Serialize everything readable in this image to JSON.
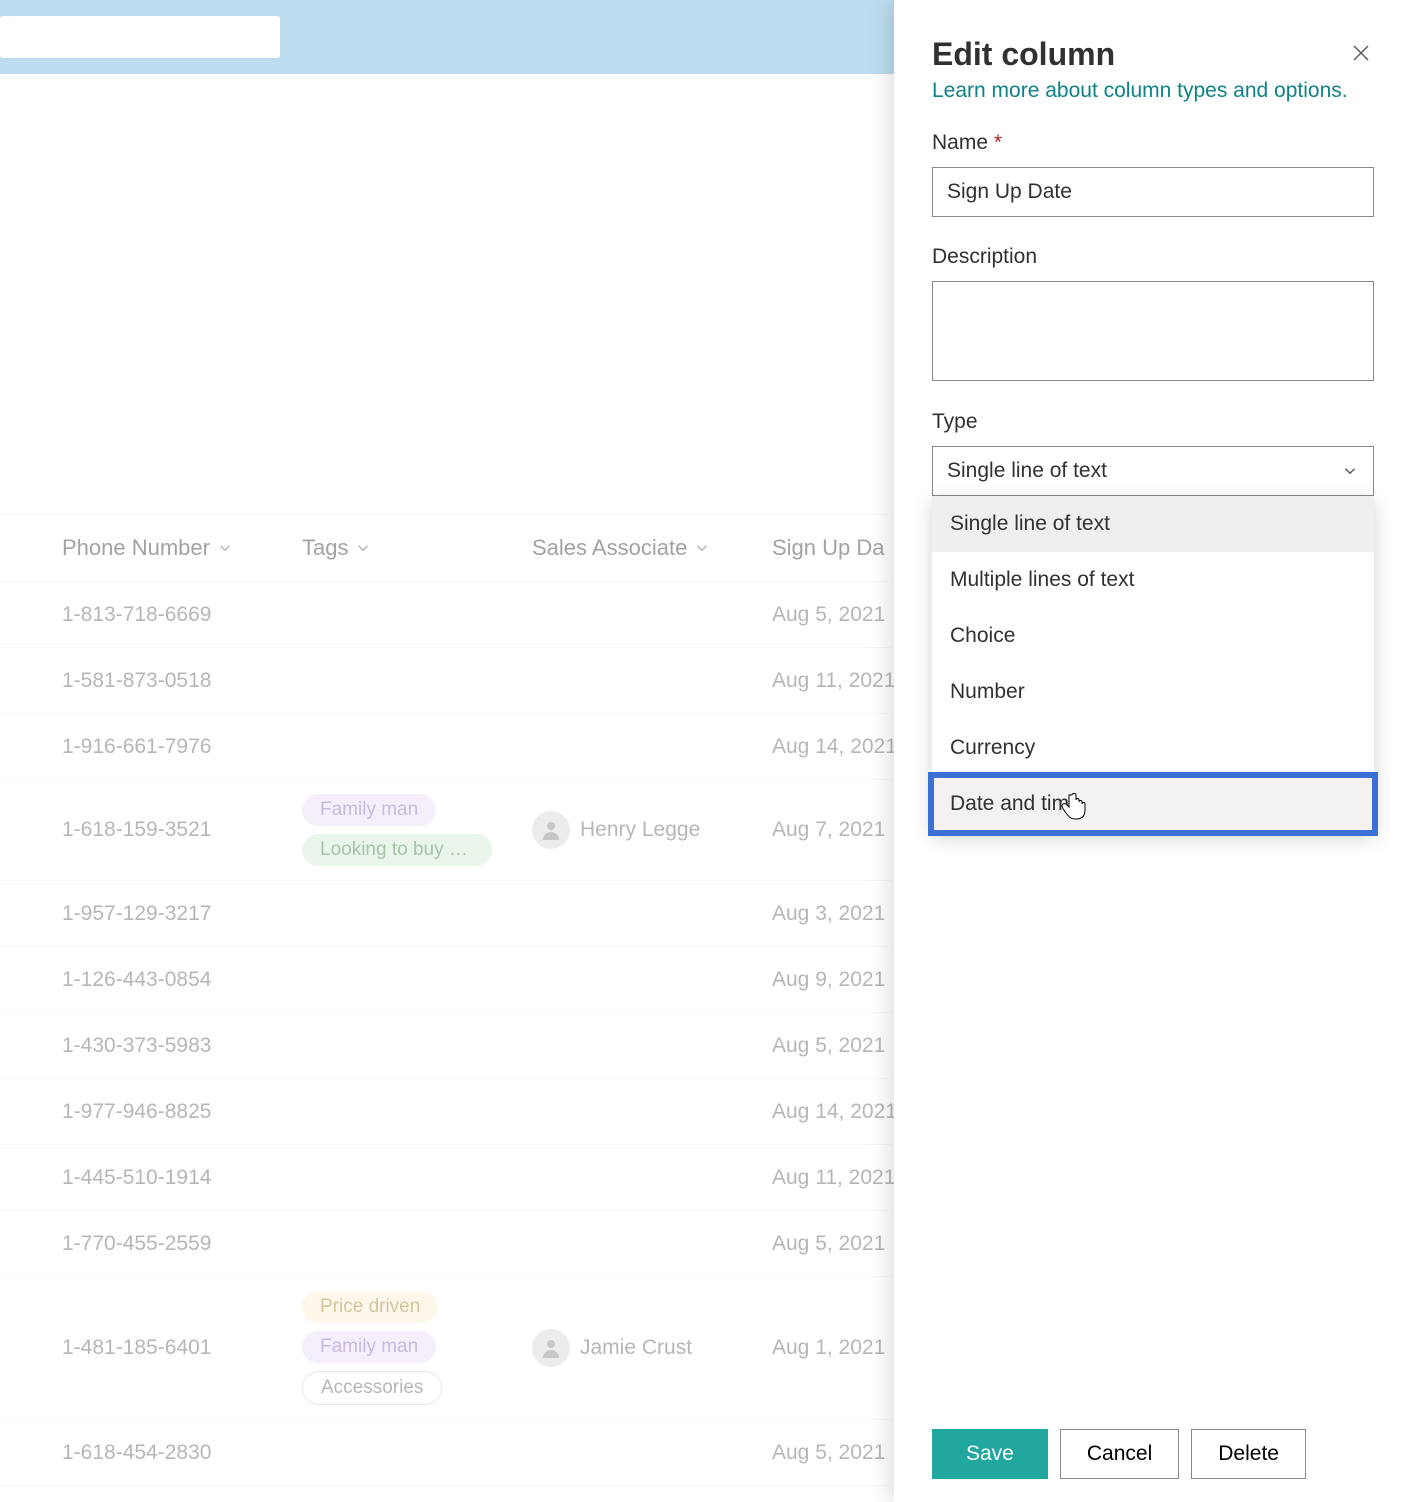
{
  "panel": {
    "title": "Edit column",
    "learn_more": "Learn more about column types and options.",
    "name_label": "Name",
    "name_required": "*",
    "name_value": "Sign Up Date",
    "description_label": "Description",
    "description_value": "",
    "type_label": "Type",
    "type_value": "Single line of text",
    "type_options": [
      "Single line of text",
      "Multiple lines of text",
      "Choice",
      "Number",
      "Currency",
      "Date and time"
    ]
  },
  "buttons": {
    "save": "Save",
    "cancel": "Cancel",
    "delete": "Delete"
  },
  "table": {
    "headers": {
      "phone": "Phone Number",
      "tags": "Tags",
      "assoc": "Sales Associate",
      "date": "Sign Up Da"
    },
    "rows": [
      {
        "phone": "1-813-718-6669",
        "tags": [],
        "assoc": "",
        "date": "Aug 5, 2021"
      },
      {
        "phone": "1-581-873-0518",
        "tags": [],
        "assoc": "",
        "date": "Aug 11, 2021"
      },
      {
        "phone": "1-916-661-7976",
        "tags": [],
        "assoc": "",
        "date": "Aug 14, 2021"
      },
      {
        "phone": "1-618-159-3521",
        "tags": [
          {
            "text": "Family man",
            "c": "purple"
          },
          {
            "text": "Looking to buy s...",
            "c": "green"
          }
        ],
        "assoc": "Henry Legge",
        "date": "Aug 7, 2021"
      },
      {
        "phone": "1-957-129-3217",
        "tags": [],
        "assoc": "",
        "date": "Aug 3, 2021"
      },
      {
        "phone": "1-126-443-0854",
        "tags": [],
        "assoc": "",
        "date": "Aug 9, 2021"
      },
      {
        "phone": "1-430-373-5983",
        "tags": [],
        "assoc": "",
        "date": "Aug 5, 2021"
      },
      {
        "phone": "1-977-946-8825",
        "tags": [],
        "assoc": "",
        "date": "Aug 14, 2021"
      },
      {
        "phone": "1-445-510-1914",
        "tags": [],
        "assoc": "",
        "date": "Aug 11, 2021"
      },
      {
        "phone": "1-770-455-2559",
        "tags": [],
        "assoc": "",
        "date": "Aug 5, 2021"
      },
      {
        "phone": "1-481-185-6401",
        "tags": [
          {
            "text": "Price driven",
            "c": "orange"
          },
          {
            "text": "Family man",
            "c": "purple"
          },
          {
            "text": "Accessories",
            "c": "white"
          }
        ],
        "assoc": "Jamie Crust",
        "date": "Aug 1, 2021"
      },
      {
        "phone": "1-618-454-2830",
        "tags": [],
        "assoc": "",
        "date": "Aug 5, 2021"
      }
    ]
  },
  "colors": {
    "accent": "#21a7a0",
    "link": "#0d8387",
    "highlight": "#3b6fd6"
  }
}
